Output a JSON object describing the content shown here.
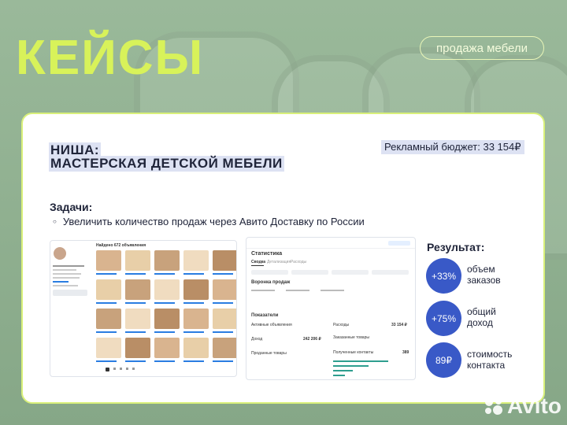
{
  "header": {
    "title": "КЕЙСЫ",
    "tag": "продажа мебели"
  },
  "niche": {
    "label": "НИША:",
    "value": "МАСТЕРСКАЯ ДЕТСКОЙ МЕБЕЛИ"
  },
  "budget": "Рекламный бюджет: 33 154₽",
  "tasks": {
    "heading": "Задачи:",
    "items": [
      "Увеличить количество продаж через Авито Доставку по России"
    ]
  },
  "results": {
    "heading": "Результат:",
    "items": [
      {
        "value": "+33%",
        "line1": "объем",
        "line2": "заказов"
      },
      {
        "value": "+75%",
        "line1": "общий",
        "line2": "доход"
      },
      {
        "value": "89₽",
        "line1": "стоимость",
        "line2": "контакта"
      }
    ]
  },
  "stats_shot": {
    "title": "Статистика",
    "tabs": [
      "Сводка",
      "Детализация",
      "Расходы"
    ],
    "section1": "Воронка продаж",
    "section2": "Показатели",
    "row1": "Активные объявления",
    "row2": "Доход",
    "row3": "Проданные товары",
    "row4": "Полученные контакты",
    "side1": "Расходы",
    "side2": "Заказанные товары",
    "val1": "33 154 ₽",
    "val2": "242 206 ₽",
    "val3": "389"
  },
  "profile_shot": {
    "header": "Найдено 672 объявления"
  },
  "watermark": "Avito"
}
